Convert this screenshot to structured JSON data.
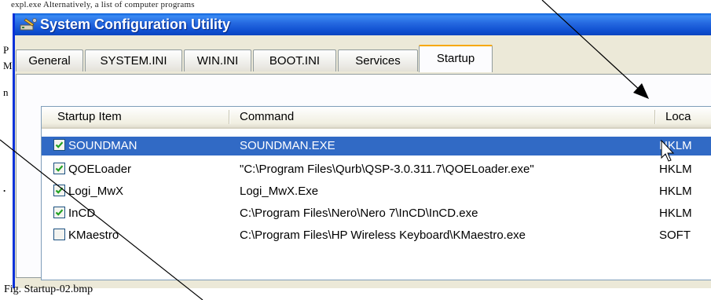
{
  "background": {
    "top_text": "expl.exe  Alternatively, a list of computer programs"
  },
  "caption": "Fig. Startup-02.bmp",
  "window": {
    "title": "System Configuration Utility",
    "tabs": [
      {
        "label": "General"
      },
      {
        "label": "SYSTEM.INI"
      },
      {
        "label": "WIN.INI"
      },
      {
        "label": "BOOT.INI"
      },
      {
        "label": "Services"
      },
      {
        "label": "Startup"
      }
    ],
    "active_tab": "Startup"
  },
  "startup_list": {
    "columns": [
      "Startup Item",
      "Command",
      "Loca"
    ],
    "rows": [
      {
        "checked": true,
        "item": "SOUNDMAN",
        "command": "SOUNDMAN.EXE",
        "location": "HKLM",
        "selected": true
      },
      {
        "checked": true,
        "item": "QOELoader",
        "command": "\"C:\\Program Files\\Qurb\\QSP-3.0.311.7\\QOELoader.exe\"",
        "location": "HKLM",
        "selected": false
      },
      {
        "checked": true,
        "item": "Logi_MwX",
        "command": "Logi_MwX.Exe",
        "location": "HKLM",
        "selected": false
      },
      {
        "checked": true,
        "item": "InCD",
        "command": "C:\\Program Files\\Nero\\Nero 7\\InCD\\InCD.exe",
        "location": "HKLM",
        "selected": false
      },
      {
        "checked": false,
        "item": "KMaestro",
        "command": "C:\\Program Files\\HP Wireless Keyboard\\KMaestro.exe",
        "location": "SOFT",
        "selected": false
      }
    ]
  },
  "colors": {
    "selection": "#316ac5",
    "titlebar": "#0a5fd8",
    "check": "#21a121",
    "active_tab_accent": "#f7a800"
  }
}
